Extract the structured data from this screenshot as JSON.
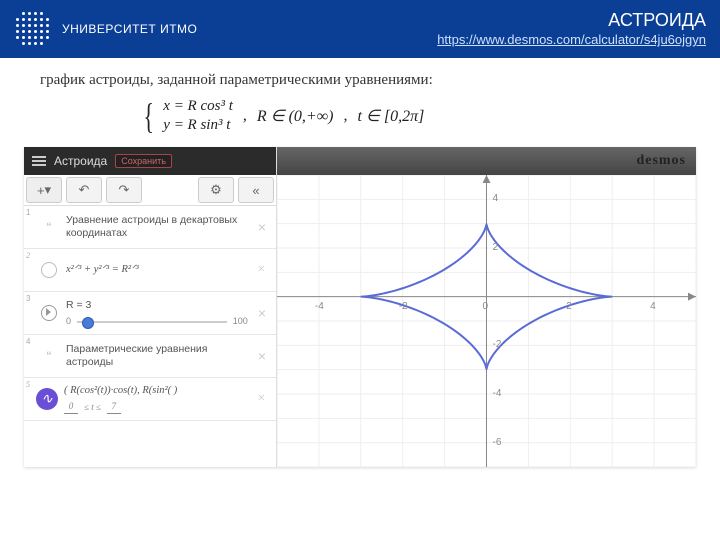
{
  "header": {
    "brand": "УНИВЕРСИТЕТ ИТМО",
    "title": "АСТРОИДА",
    "url": "https://www.desmos.com/calculator/s4ju6ojgyn"
  },
  "description": "график астроиды, заданной параметрическими уравнениями:",
  "formula": {
    "line1": "x = R cos³ t",
    "line2": "y = R sin³ t",
    "domainR": "R ∈ (0,+∞)",
    "domainT": "t ∈ [0,2π]"
  },
  "app": {
    "topbar": {
      "title": "Астроида",
      "save": "Сохранить"
    },
    "toolbar": {
      "plus": "+",
      "undo": "↶",
      "redo": "↷",
      "gear": "⚙",
      "collapse": "«"
    },
    "rows": [
      {
        "num": "1",
        "kind": "note",
        "text": "Уравнение астроиды в декартовых координатах"
      },
      {
        "num": "2",
        "kind": "eq",
        "text": "x²ᐟ³ + y²ᐟ³ = R²ᐟ³"
      },
      {
        "num": "3",
        "kind": "slider",
        "text": "R = 3",
        "min": "0",
        "max": "100",
        "pos": 3
      },
      {
        "num": "4",
        "kind": "note",
        "text": "Параметрические уравнения астроиды"
      },
      {
        "num": "5",
        "kind": "param",
        "text": "( R(cos²(t))·cos(t), R(sin²( )",
        "tmin": "0",
        "tmax": "7"
      }
    ],
    "desmos_logo": "desmos"
  },
  "chart_data": {
    "type": "line",
    "title": "",
    "xlabel": "",
    "ylabel": "",
    "xlim": [
      -5,
      5
    ],
    "ylim": [
      -7,
      5
    ],
    "xticks": [
      -4,
      -2,
      0,
      2,
      4
    ],
    "yticks": [
      -6,
      -4,
      -2,
      2,
      4
    ],
    "series": [
      {
        "name": "astroid R=3",
        "parametric": true,
        "R": 3,
        "x_of_t": "R*cos(t)^3",
        "y_of_t": "R*sin(t)^3",
        "t_range": [
          0,
          6.283185
        ],
        "cusps": [
          [
            3,
            0
          ],
          [
            0,
            3
          ],
          [
            -3,
            0
          ],
          [
            0,
            -3
          ]
        ]
      }
    ]
  }
}
